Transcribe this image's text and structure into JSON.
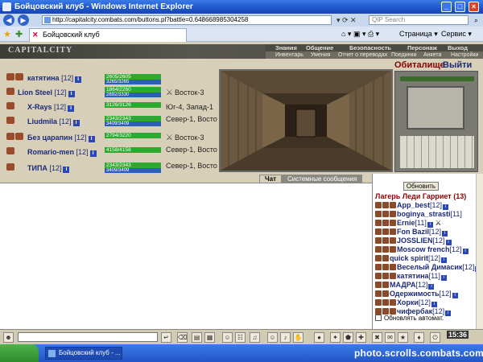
{
  "window": {
    "title": "Бойцовский клуб - Windows Internet Explorer",
    "buttons": [
      "_",
      "□",
      "×"
    ]
  },
  "address": {
    "url": "http://capitalcity.combats.com/buttons.pl?battle=0.648668985304258",
    "search_placeholder": "QIP Search"
  },
  "tab": {
    "label": "Бойцовский клуб",
    "page_label": "Страница",
    "service_label": "Сервис"
  },
  "game": {
    "logo": "CAPITALCITY",
    "menu1": [
      "Знания",
      "Общение",
      "Безопасность",
      "Персонаж",
      "Выход"
    ],
    "menu2": [
      "Инвентарь",
      "Умения",
      "Отчет о переводах",
      "Поединки",
      "Анкета",
      "Настройки"
    ],
    "location_title": "Обиталище",
    "exit_label": "Выйти"
  },
  "players": [
    {
      "name": "катятина",
      "level": "[12]",
      "hp": "2605/2605",
      "mp": "3265/3265",
      "loc": ""
    },
    {
      "name": "Lion Steel",
      "level": "[12]",
      "hp": "1864/2260",
      "mp": "2692/3330",
      "loc": "Восток-3"
    },
    {
      "name": "X-Rays",
      "level": "[12]",
      "hp": "3126/3126",
      "mp": "",
      "loc": "Юг-4, Запад-1"
    },
    {
      "name": "Liudmila",
      "level": "[12]",
      "hp": "2343/2343",
      "mp": "3409/3409",
      "loc": "Север-1, Восток-3"
    },
    {
      "name": "Без царапин",
      "level": "[12]",
      "hp": "2794/3220",
      "mp": "",
      "loc": "Восток-3"
    },
    {
      "name": "Romario-men",
      "level": "[12]",
      "hp": "4158/4158",
      "mp": "",
      "loc": "Север-1, Восток-3"
    },
    {
      "name": "ТИПА",
      "level": "[12]",
      "hp": "2343/2343",
      "mp": "3409/3409",
      "loc": "Север-1, Восток-"
    }
  ],
  "chat": {
    "tab_active": "Чат",
    "tab_other": "Системные сообщения"
  },
  "online": {
    "refresh_label": "Обновить",
    "camp_title": "Лагерь Леди Гарриет (13)",
    "users": [
      {
        "name": "App_best",
        "level": "[12]"
      },
      {
        "name": "boginya_strasti",
        "level": "[11]"
      },
      {
        "name": "Ernie",
        "level": "[11]"
      },
      {
        "name": "Fon Bazil",
        "level": "[12]"
      },
      {
        "name": "JOSSLIEN",
        "level": "[12]"
      },
      {
        "name": "Moscow french",
        "level": "[12]"
      },
      {
        "name": "quick spirit",
        "level": "[12]"
      },
      {
        "name": "Веселый Димасик",
        "level": "[12]"
      },
      {
        "name": "катятина",
        "level": "[11]"
      },
      {
        "name": "МАДРА",
        "level": "[12]"
      },
      {
        "name": "Одержимость",
        "level": "[12]"
      },
      {
        "name": "Хорки",
        "level": "[12]"
      },
      {
        "name": "чифербак",
        "level": "[12]"
      }
    ],
    "auto_update_label": "Обновлять автомат."
  },
  "toolbar": {
    "clock": "15:36"
  },
  "taskbar": {
    "item_label": "Бойцовский клуб - ..."
  },
  "watermark": "photo.scrolls.combats.com",
  "colors": {
    "titlebar": "#1d55c9",
    "game_bg": "#d7cfb8",
    "name_blue": "#1c2a7a",
    "location_red": "#8b0000"
  }
}
